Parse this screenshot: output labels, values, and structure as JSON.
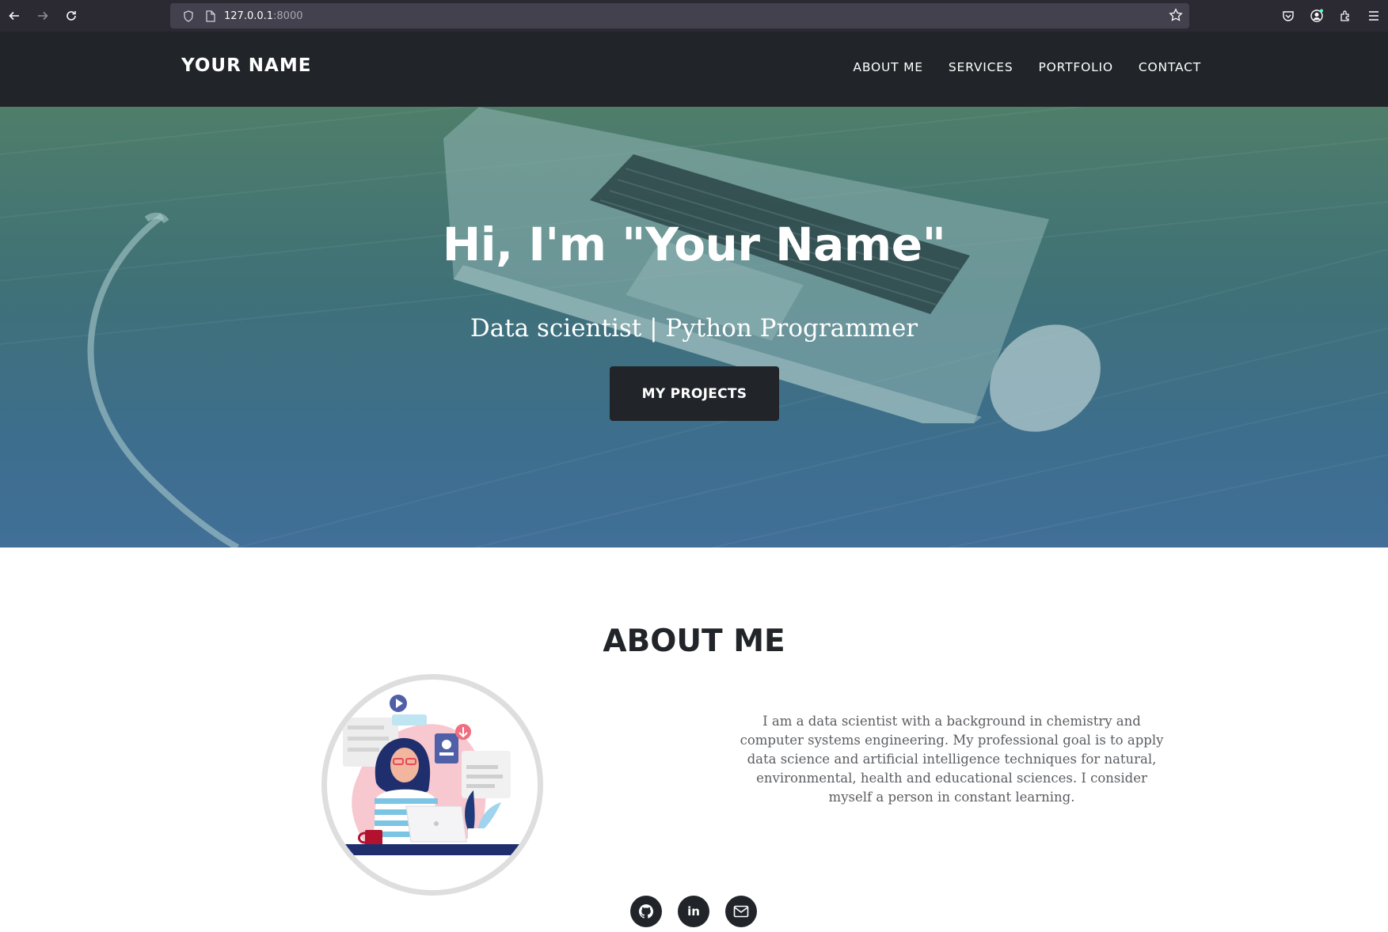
{
  "browser": {
    "url_host": "127.0.0.1",
    "url_port": ":8000"
  },
  "nav": {
    "brand": "YOUR NAME",
    "links": [
      "ABOUT ME",
      "SERVICES",
      "PORTFOLIO",
      "CONTACT"
    ]
  },
  "hero": {
    "title": "Hi, I'm \"Your Name\"",
    "subtitle": "Data scientist | Python Programmer",
    "button_label": "MY PROJECTS"
  },
  "about": {
    "title": "ABOUT ME",
    "text": "I am a data scientist with a background in chemistry and computer systems engineering. My professional goal is to apply data science and artificial intelligence techniques for natural, environmental, health and educational sciences. I consider myself a person in constant learning."
  },
  "socials": {
    "icons": [
      "github-icon",
      "linkedin-icon",
      "email-icon"
    ],
    "linkedin_text": "in"
  },
  "colors": {
    "nav_bg": "#212529",
    "hero_gradient_top": "#4f7e6a",
    "hero_gradient_bottom": "#416f98",
    "text_dark": "#212529",
    "text_muted": "#5a5d61"
  }
}
